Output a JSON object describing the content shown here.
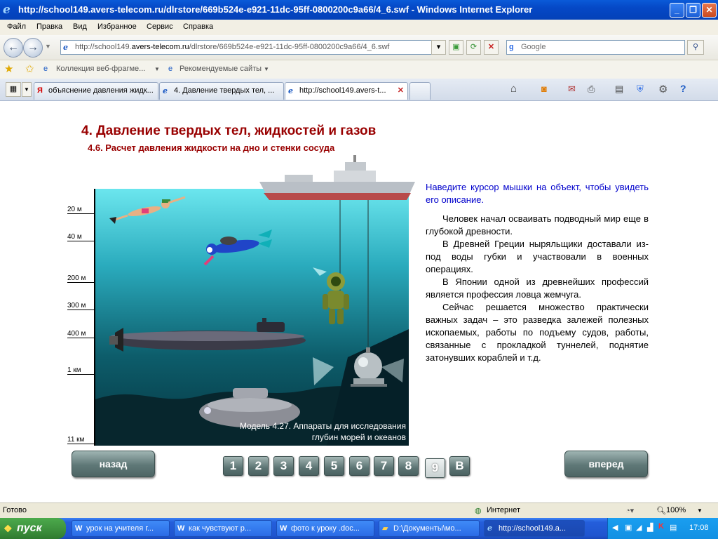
{
  "window": {
    "title": "http://school149.avers-telecom.ru/dlrstore/669b524e-e921-11dc-95ff-0800200c9a66/4_6.swf - Windows Internet Explorer",
    "minimize_icon": "minimize-icon",
    "maximize_icon": "maximize-icon",
    "close_icon": "close-icon"
  },
  "menu": [
    "Файл",
    "Правка",
    "Вид",
    "Избранное",
    "Сервис",
    "Справка"
  ],
  "address": {
    "url_prefix": "http://school149.",
    "url_domain": "avers-telecom.ru",
    "url_suffix": "/dlrstore/669b524e-e921-11dc-95ff-0800200c9a66/4_6.swf",
    "search_placeholder": "Google"
  },
  "favorites": {
    "item1": "Коллекция веб-фрагме...",
    "item2": "Рекомендуемые сайты"
  },
  "tabs": [
    {
      "label": "объяснение давления жидк...",
      "icon": "yandex-icon"
    },
    {
      "label": "4. Давление твердых тел, ...",
      "icon": "ie-icon"
    },
    {
      "label": "http://school149.avers-t...",
      "icon": "ie-icon"
    }
  ],
  "page": {
    "title": "4. Давление твердых тел, жидкостей и газов",
    "subtitle": "4.6. Расчет давления жидкости на дно и стенки сосуда",
    "hint": "Наведите курсор мышки на объект, чтобы увидеть его описание.",
    "paragraphs": [
      "Человек начал осваивать подводный мир еще в глубокой древности.",
      "В Древней Греции ныряльщики доставали из-под воды губки и участвовали в военных операциях.",
      "В Японии одной из древнейших профессий является профессия ловца жемчуга.",
      "Сейчас решается множество практически важных задач – это разведка залежей полезных ископаемых, работы по подъему судов, работы, связанные с прокладкой туннелей, поднятие затонувших кораблей и т.д."
    ],
    "caption_line1": "Модель 4.27. Аппараты для исследования",
    "caption_line2": "глубин морей и океанов",
    "depth_scale": [
      "20 м",
      "40 м",
      "200 м",
      "300 м",
      "400 м",
      "1 км",
      "11 км"
    ],
    "back_label": "назад",
    "next_label": "вперед",
    "pages": [
      "1",
      "2",
      "3",
      "4",
      "5",
      "6",
      "7",
      "8",
      "9",
      "В"
    ],
    "current_page": "9"
  },
  "status": {
    "left": "Готово",
    "zone": "Интернет",
    "zoom": "100%"
  },
  "taskbar": {
    "start_label": "пуск",
    "tasks": [
      "урок на учителя г...",
      "как чувствуют р...",
      "фото к уроку .doc...",
      "D:\\Документы\\мо...",
      "http://school149.a..."
    ],
    "clock": "17:08"
  }
}
